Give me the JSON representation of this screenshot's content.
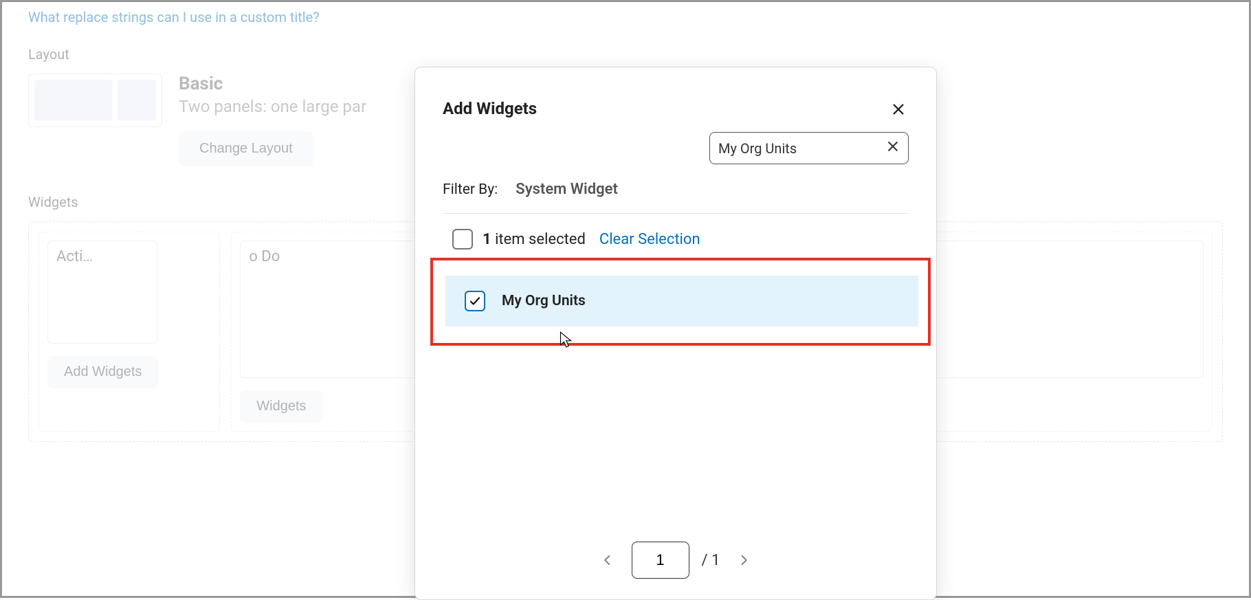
{
  "help_link": "What replace strings can I use in a custom title?",
  "layout": {
    "section_label": "Layout",
    "name": "Basic",
    "description_visible": "Two panels: one large par",
    "change_button": "Change Layout"
  },
  "widgets": {
    "section_label": "Widgets",
    "left_column": {
      "cards": [
        "Acti…"
      ],
      "add_button": "Add Widgets"
    },
    "right_column": {
      "cards_partial": [
        "o Do"
      ],
      "add_button_partial": "Widgets"
    }
  },
  "modal": {
    "title": "Add Widgets",
    "search_value": "My Org Units",
    "filter_label": "Filter By:",
    "filter_value": "System Widget",
    "selection": {
      "count": "1",
      "suffix": " item selected",
      "clear": "Clear Selection"
    },
    "results": [
      {
        "label": "My Org Units",
        "checked": true
      }
    ],
    "pager": {
      "current": "1",
      "total_display": "/ 1"
    }
  }
}
